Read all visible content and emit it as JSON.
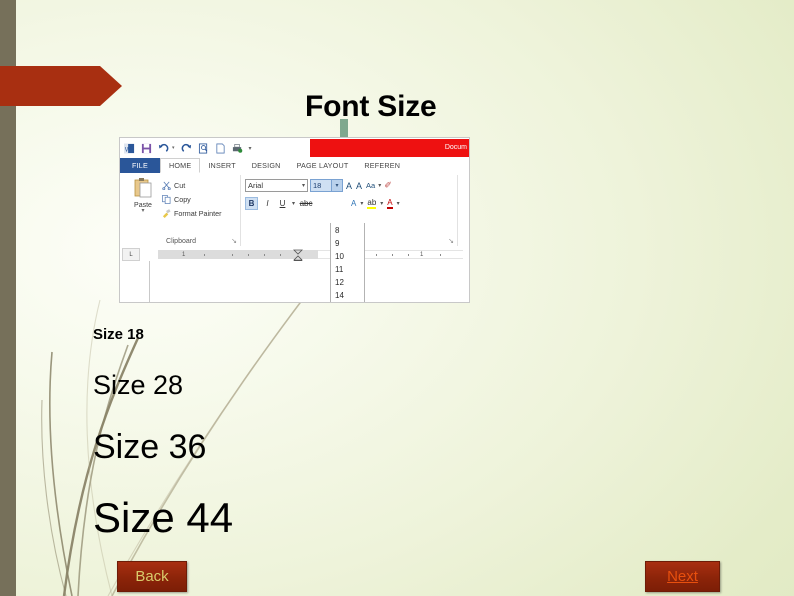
{
  "slide": {
    "title": "Font Size",
    "theme_colors": {
      "background_light": "#fdfef8",
      "background_green": "#dfe8c0",
      "stripe": "#76705a",
      "banner_red": "#a82f11",
      "arrow_green": "#7fa88e"
    }
  },
  "banner": {
    "name": "red-banner-arrow"
  },
  "pointer": {
    "name": "green-down-arrow"
  },
  "word_screenshot": {
    "title_bar": {
      "document_name": "Docum"
    },
    "quick_access": {
      "icons": [
        "word-app-icon",
        "save-icon",
        "undo-icon",
        "redo-icon",
        "print-preview-icon",
        "new-document-icon",
        "quick-print-icon",
        "customize-qat-icon"
      ]
    },
    "tabs": [
      {
        "label": "FILE",
        "state": "file"
      },
      {
        "label": "HOME",
        "state": "active"
      },
      {
        "label": "INSERT",
        "state": "normal"
      },
      {
        "label": "DESIGN",
        "state": "normal"
      },
      {
        "label": "PAGE LAYOUT",
        "state": "normal"
      },
      {
        "label": "REFEREN",
        "state": "normal"
      }
    ],
    "clipboard_group": {
      "label": "Clipboard",
      "paste_label": "Paste",
      "commands": [
        {
          "label": "Cut",
          "icon": "scissors-icon"
        },
        {
          "label": "Copy",
          "icon": "copy-icon"
        },
        {
          "label": "Format Painter",
          "icon": "paintbrush-icon"
        }
      ],
      "launcher": "↘"
    },
    "font_group": {
      "font_name": "Arial",
      "font_size": "18",
      "grow_font": "A",
      "shrink_font": "A",
      "change_case": "Aa",
      "clear_formatting": "✐",
      "bold": "B",
      "italic": "I",
      "underline": "U",
      "strikethrough": "abc",
      "text_effects": "A",
      "highlight": "ab",
      "font_color": "A",
      "launcher": "↘"
    },
    "size_dropdown": {
      "options": [
        "8",
        "9",
        "10",
        "11",
        "12",
        "14"
      ]
    },
    "ruler": {
      "tab_selector": "L",
      "left_mark": "1",
      "right_mark": "1"
    }
  },
  "samples": [
    {
      "text": "Size 18",
      "size": 18
    },
    {
      "text": "Size 28",
      "size": 28
    },
    {
      "text": "Size 36",
      "size": 36
    },
    {
      "text": "Size 44",
      "size": 44
    }
  ],
  "navigation": {
    "back_label": "Back",
    "next_label": "Next"
  }
}
